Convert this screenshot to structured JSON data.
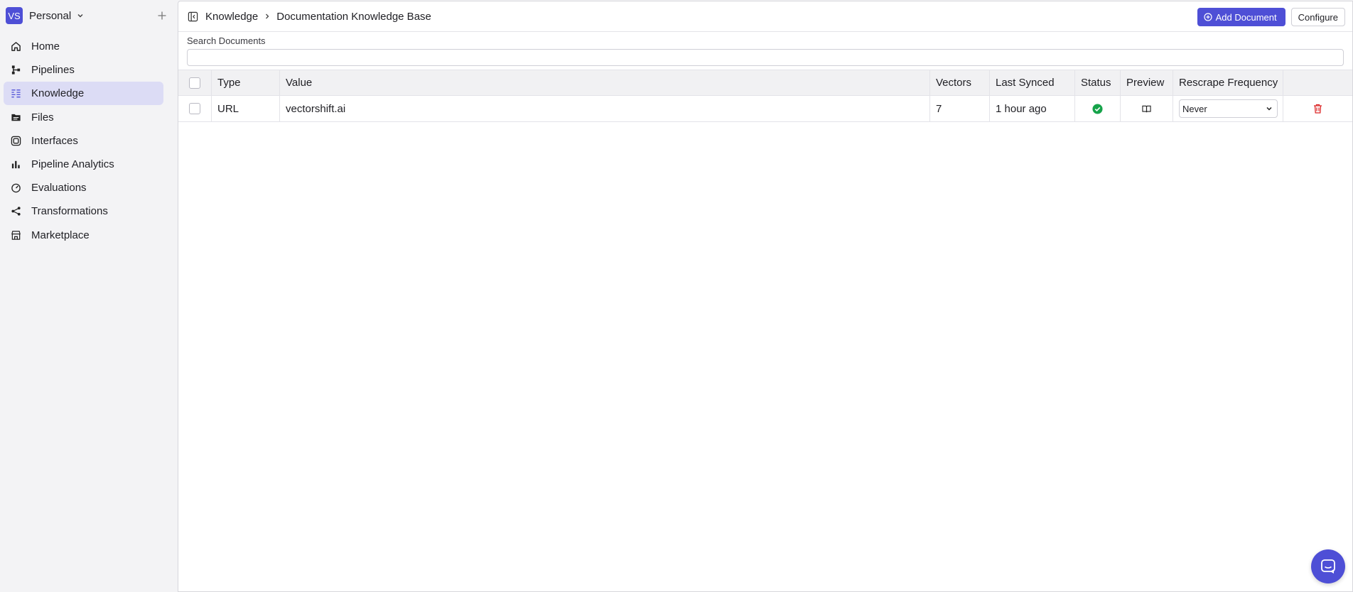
{
  "workspace": {
    "initials": "VS",
    "name": "Personal"
  },
  "nav": [
    {
      "label": "Home",
      "icon": "home-icon"
    },
    {
      "label": "Pipelines",
      "icon": "pipelines-icon"
    },
    {
      "label": "Knowledge",
      "icon": "knowledge-icon",
      "active": true
    },
    {
      "label": "Files",
      "icon": "files-icon"
    },
    {
      "label": "Interfaces",
      "icon": "interfaces-icon"
    },
    {
      "label": "Pipeline Analytics",
      "icon": "analytics-icon"
    },
    {
      "label": "Evaluations",
      "icon": "evaluations-icon"
    },
    {
      "label": "Transformations",
      "icon": "transformations-icon"
    },
    {
      "label": "Marketplace",
      "icon": "marketplace-icon"
    }
  ],
  "breadcrumb": {
    "parent": "Knowledge",
    "current": "Documentation Knowledge Base"
  },
  "actions": {
    "add_document": "Add Document",
    "configure": "Configure"
  },
  "search": {
    "label": "Search Documents",
    "value": "",
    "placeholder": ""
  },
  "table": {
    "headers": {
      "type": "Type",
      "value": "Value",
      "vectors": "Vectors",
      "last_synced": "Last Synced",
      "status": "Status",
      "preview": "Preview",
      "rescrape_frequency": "Rescrape Frequency"
    },
    "rows": [
      {
        "type": "URL",
        "value": "vectorshift.ai",
        "vectors": "7",
        "last_synced": "1 hour ago",
        "status": "success",
        "rescrape_frequency": "Never"
      }
    ]
  },
  "colors": {
    "accent": "#4e4fd6",
    "success": "#16a34a",
    "danger": "#dc2626",
    "active_nav": "#dcdcf5"
  }
}
